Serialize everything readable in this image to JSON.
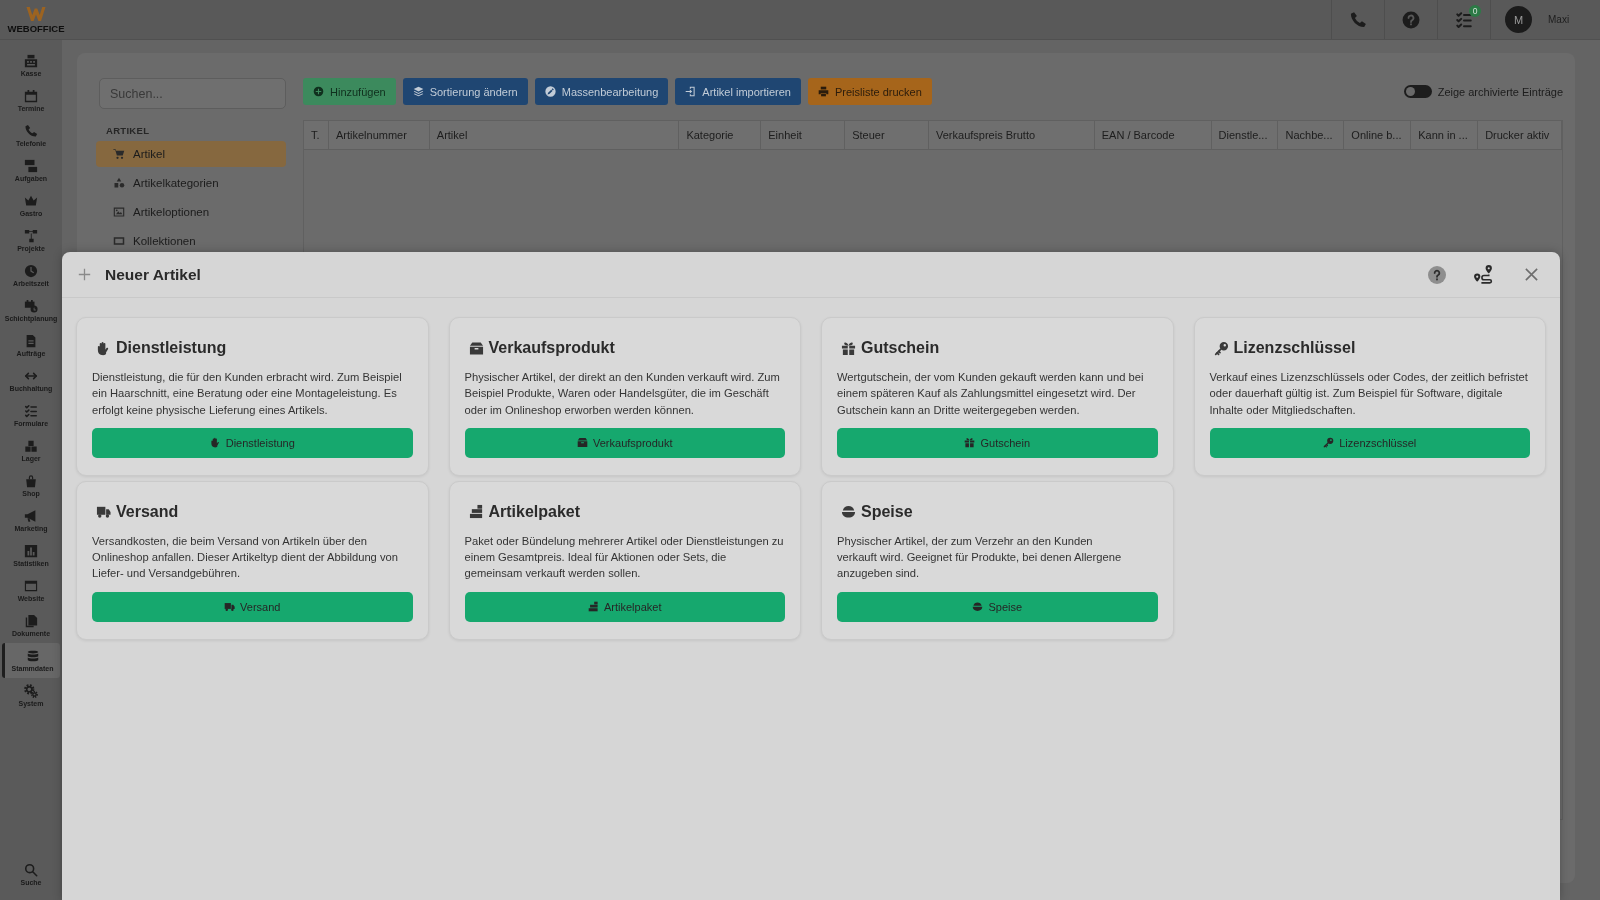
{
  "top_bar": {
    "logo_text": "WEBOFFICE",
    "badge": "0",
    "avatar_initial": "M",
    "user_name": "Maxi"
  },
  "sidebar": {
    "items": [
      {
        "kind": "register",
        "label": "Kasse",
        "selected": false
      },
      {
        "kind": "calendar",
        "label": "Termine",
        "selected": false
      },
      {
        "kind": "phone",
        "label": "Telefonie",
        "selected": false
      },
      {
        "kind": "board",
        "label": "Aufgaben",
        "selected": false
      },
      {
        "kind": "crown",
        "label": "Gastro",
        "selected": false
      },
      {
        "kind": "nodes",
        "label": "Projekte",
        "selected": false
      },
      {
        "kind": "clock",
        "label": "Arbeitszeit",
        "selected": false
      },
      {
        "kind": "shifts",
        "label": "Schichtplanung",
        "selected": false
      },
      {
        "kind": "document",
        "label": "Aufträge",
        "selected": false
      },
      {
        "kind": "arrows",
        "label": "Buchhaltung",
        "selected": false
      },
      {
        "kind": "checklist",
        "label": "Formulare",
        "selected": false
      },
      {
        "kind": "boxes",
        "label": "Lager",
        "selected": false
      },
      {
        "kind": "bag",
        "label": "Shop",
        "selected": false
      },
      {
        "kind": "megaphone",
        "label": "Marketing",
        "selected": false
      },
      {
        "kind": "chart",
        "label": "Statistiken",
        "selected": false
      },
      {
        "kind": "browser",
        "label": "Website",
        "selected": false
      },
      {
        "kind": "files",
        "label": "Dokumente",
        "selected": false
      },
      {
        "kind": "database",
        "label": "Stammdaten",
        "selected": true
      },
      {
        "kind": "gears",
        "label": "System",
        "selected": false
      }
    ],
    "search": {
      "kind": "search",
      "label": "Suche"
    }
  },
  "panel": {
    "search": {
      "placeholder": "Suchen..."
    },
    "section": "ARTIKEL",
    "items": [
      {
        "kind": "cart",
        "label": "Artikel",
        "selected": true
      },
      {
        "kind": "shapes",
        "label": "Artikelkategorien",
        "selected": false
      },
      {
        "kind": "image",
        "label": "Artikeloptionen",
        "selected": false
      },
      {
        "kind": "frame",
        "label": "Kollektionen",
        "selected": false
      }
    ]
  },
  "toolbar": {
    "buttons": [
      {
        "kind": "add",
        "label": "Hinzufügen"
      },
      {
        "kind": "sort",
        "label": "Sortierung ändern"
      },
      {
        "kind": "bulk",
        "label": "Massenbearbeitung"
      },
      {
        "kind": "import",
        "label": "Artikel importieren"
      },
      {
        "kind": "print",
        "label": "Preisliste drucken"
      }
    ],
    "archived_toggle": {
      "label": "Zeige archivierte Einträge",
      "on": false
    }
  },
  "table": {
    "columns": [
      "T.",
      "Artikelnummer",
      "Artikel",
      "Kategorie",
      "Einheit",
      "Steuer",
      "Verkaufspreis Brutto",
      "EAN / Barcode",
      "Dienstle...",
      "Nachbe...",
      "Online b...",
      "Kann in ...",
      "Drucker aktiv"
    ]
  },
  "modal": {
    "title": "Neuer Artikel",
    "cards": [
      {
        "kind": "service",
        "title": "Dienstleistung",
        "description": "Dienstleistung, die für den Kunden erbracht wird. Zum Beispiel ein Haarschnitt, eine Beratung oder eine Montageleistung. Es erfolgt keine physische Lieferung eines Artikels.",
        "button": "Dienstleistung"
      },
      {
        "kind": "product",
        "title": "Verkaufsprodukt",
        "description": "Physischer Artikel, der direkt an den Kunden verkauft wird. Zum Beispiel Produkte, Waren oder Handelsgüter, die im Geschäft oder im Onlineshop erworben werden können.",
        "button": "Verkaufsprodukt"
      },
      {
        "kind": "voucher",
        "title": "Gutschein",
        "description": "Wertgutschein, der vom Kunden gekauft werden kann und bei einem späteren Kauf als Zahlungsmittel eingesetzt wird. Der Gutschein kann an Dritte weitergegeben werden.",
        "button": "Gutschein"
      },
      {
        "kind": "license",
        "title": "Lizenzschlüssel",
        "description": "Verkauf eines Lizenzschlüssels oder Codes, der zeitlich befristet oder dauerhaft gültig ist. Zum Beispiel für Software, digitale Inhalte oder Mitgliedschaften.",
        "button": "Lizenzschlüssel"
      },
      {
        "kind": "shipping",
        "title": "Versand",
        "description": "Versandkosten, die beim Versand von Artikeln über den Onlineshop anfallen. Dieser Artikeltyp dient der Abbildung von Liefer- und Versandgebühren.",
        "button": "Versand"
      },
      {
        "kind": "bundle",
        "title": "Artikelpaket",
        "description": "Paket oder Bündelung mehrerer Artikel oder Dienstleistungen zu einem Gesamtpreis. Ideal für Aktionen oder Sets, die gemeinsam verkauft werden sollen.",
        "button": "Artikelpaket"
      },
      {
        "kind": "food",
        "title": "Speise",
        "description": "Physischer Artikel, der zum Verzehr an den Kunden verkauft wird. Geeignet für Produkte, bei denen Allergene anzugeben sind.",
        "button": "Speise"
      }
    ]
  }
}
